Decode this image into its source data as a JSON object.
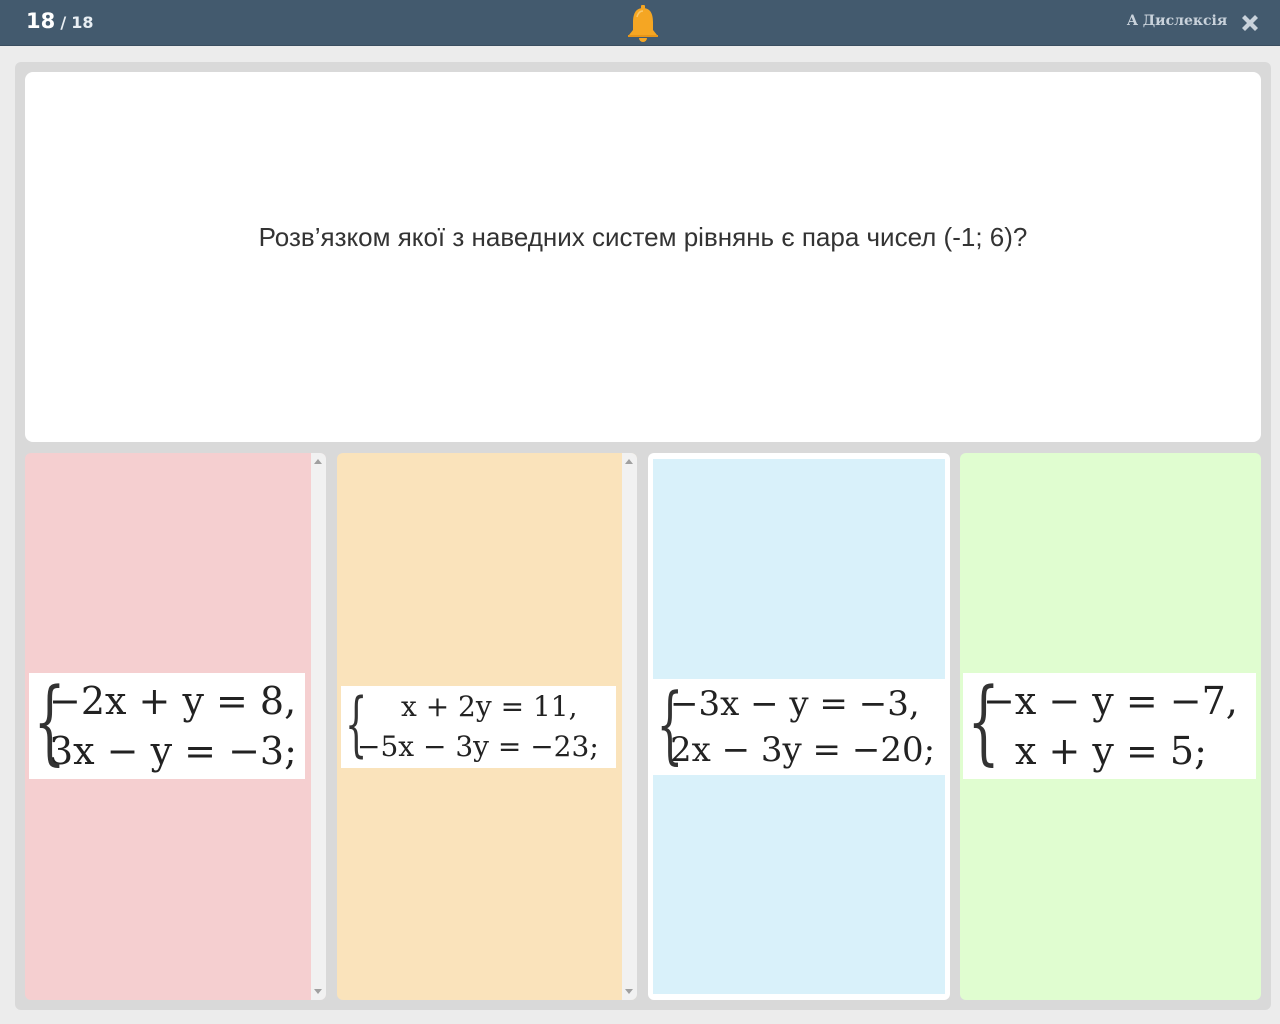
{
  "header": {
    "current": "18",
    "separator": "/",
    "total": "18",
    "dyslexia_label": "A Дислексія",
    "bell_color": "#f5a623",
    "bar_color": "#435a6e"
  },
  "question": {
    "text": "Розв’язком якої з наведних систем рівнянь є пара чисел (-1; 6)?"
  },
  "answers": [
    {
      "color": "#f5cfd0",
      "line1": "−2x + y = 8,",
      "line2": "3x − y = −3;"
    },
    {
      "color": "#fae3bb",
      "line1": "x + 2y = 11,",
      "line2": "−5x − 3y = −23;"
    },
    {
      "color": "#d9f1fa",
      "line1": "−3x − y = −3,",
      "line2": "2x − 3y = −20;"
    },
    {
      "color": "#e0fdd0",
      "line1": "−x − y = −7,",
      "line2": "x + y = 5;"
    }
  ],
  "icons": {
    "bell": "bell-icon",
    "close": "close-icon",
    "brace": "{"
  }
}
